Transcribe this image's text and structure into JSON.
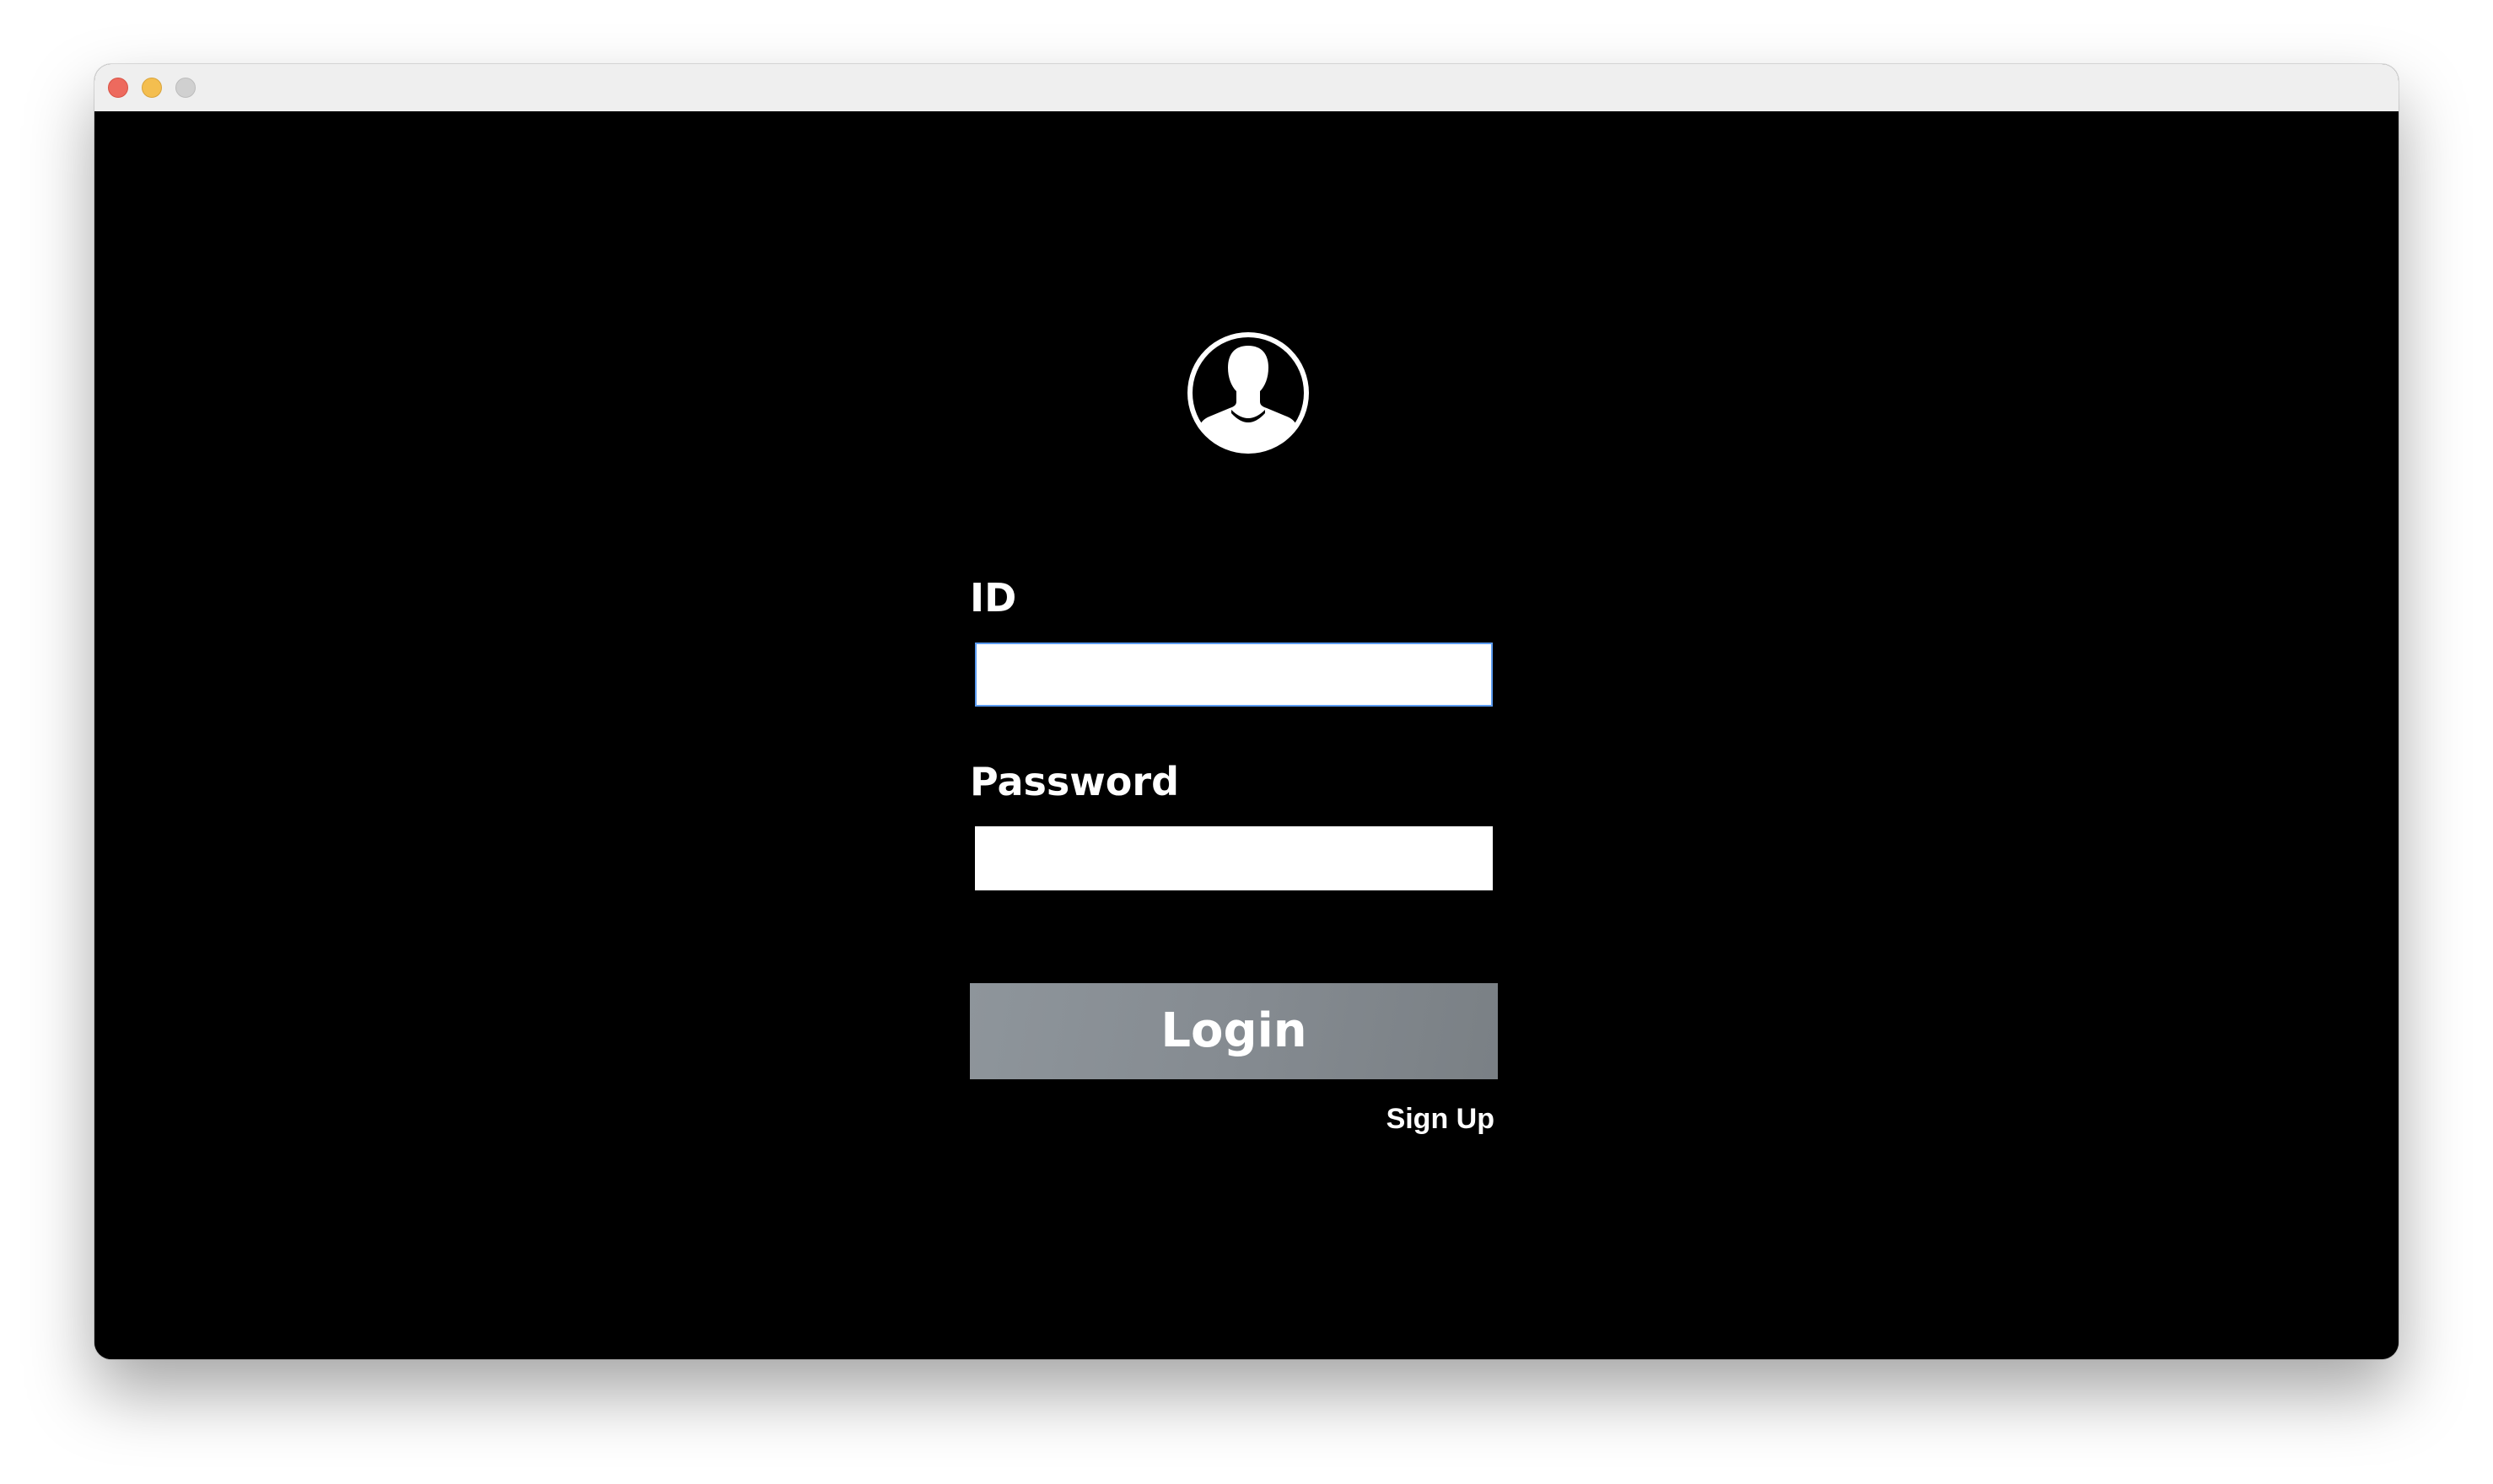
{
  "window": {
    "controls": [
      "close",
      "minimize",
      "maximize"
    ]
  },
  "avatar": {
    "icon": "user-silhouette-icon"
  },
  "form": {
    "id_label": "ID",
    "id_value": "",
    "password_label": "Password",
    "password_value": "",
    "login_label": "Login",
    "signup_label": "Sign Up"
  },
  "colors": {
    "background": "#000000",
    "button": "#858b91",
    "focus_ring": "#5b9bf0"
  }
}
